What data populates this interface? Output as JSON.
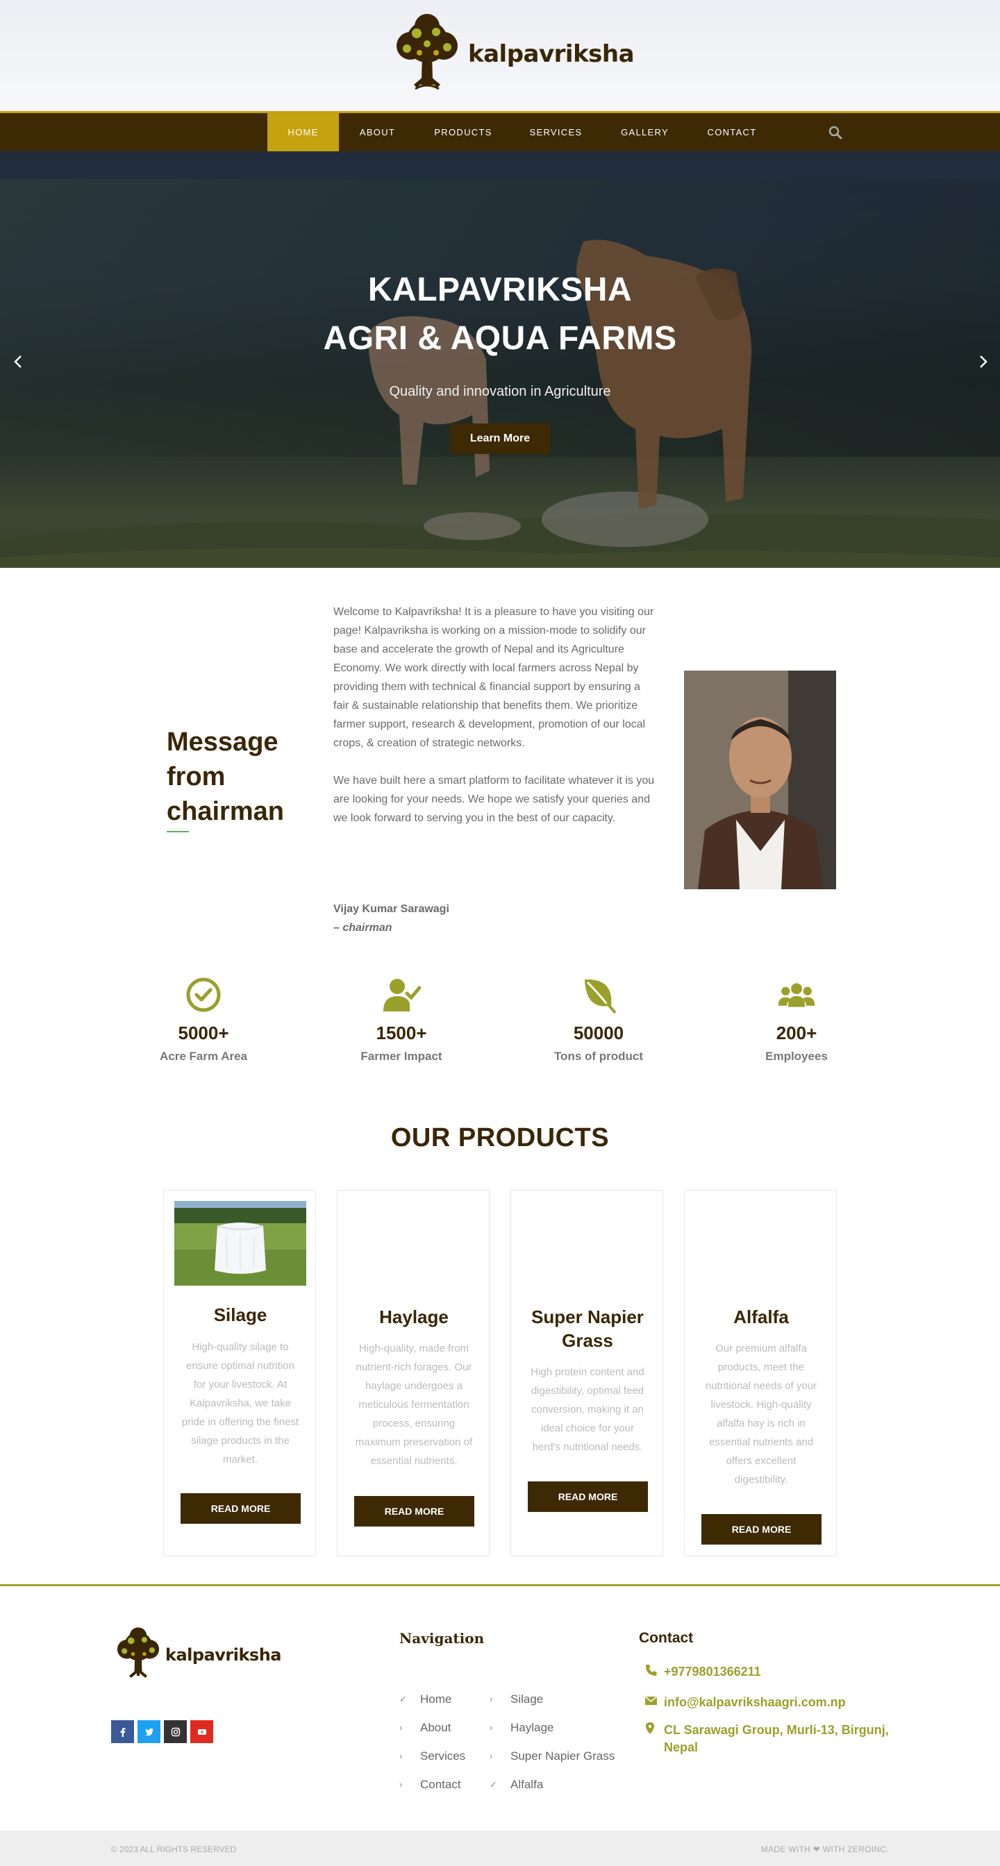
{
  "brand": {
    "name": "kalpavriksha"
  },
  "nav": {
    "items": [
      {
        "label": "HOME",
        "active": true
      },
      {
        "label": "ABOUT"
      },
      {
        "label": "PRODUCTS"
      },
      {
        "label": "SERVICES"
      },
      {
        "label": "GALLERY"
      },
      {
        "label": "CONTACT"
      }
    ],
    "search_icon": "search-icon"
  },
  "hero": {
    "title_line1": "KALPAVRIKSHA",
    "title_line2": "AGRI & AQUA FARMS",
    "subtitle": "Quality and innovation in Agriculture",
    "button": "Learn More",
    "prev_icon": "chevron-left-icon",
    "next_icon": "chevron-right-icon"
  },
  "message": {
    "heading": "Message from chairman",
    "paragraphs": [
      "Welcome to Kalpavriksha! It is a pleasure to have you visiting our page! Kalpavriksha is working on a mission-mode to solidify our base and accelerate the growth of Nepal and its Agriculture Economy. We work directly with local farmers across Nepal by providing them with technical & financial support by ensuring a fair & sustainable relationship that benefits them. We prioritize farmer support, research & development, promotion of our local crops, & creation of strategic networks.",
      "We have built here a smart platform to facilitate whatever it is you are looking for your needs. We hope we satisfy your queries and we look forward to serving you in the best of our capacity."
    ],
    "signature_name": "Vijay Kumar Sarawagi",
    "signature_role": "– chairman"
  },
  "stats": [
    {
      "icon": "check-circle-icon",
      "value": "5000+",
      "label": "Acre Farm Area"
    },
    {
      "icon": "user-check-icon",
      "value": "1500+",
      "label": "Farmer Impact"
    },
    {
      "icon": "leaf-icon",
      "value": "50000",
      "label": "Tons of product"
    },
    {
      "icon": "users-icon",
      "value": "200+",
      "label": "Employees"
    }
  ],
  "products": {
    "title": "OUR PRODUCTS",
    "items": [
      {
        "name": "Silage",
        "description": "High-quality silage to ensure optimal nutrition for your livestock. At Kalpavriksha, we take pride in offering the finest silage products in the market.",
        "button": "READ MORE"
      },
      {
        "name": "Haylage",
        "description": "High-quality, made from nutrient-rich forages. Our haylage undergoes a meticulous fermentation process, ensuring maximum preservation of essential nutrients.",
        "button": "READ MORE"
      },
      {
        "name": "Super Napier Grass",
        "description": "High protein content and digestibility, optimal feed conversion, making it an ideal choice for your herd's nutritional needs.",
        "button": "READ MORE"
      },
      {
        "name": "Alfalfa",
        "description": "Our premium alfalfa products, meet the nutritional needs of your livestock. High-quality alfalfa hay is rich in essential nutrients and offers excellent digestibility.",
        "button": "READ MORE"
      }
    ]
  },
  "footer": {
    "socials": [
      {
        "icon": "facebook-icon",
        "color": "#3b5998"
      },
      {
        "icon": "twitter-icon",
        "color": "#1da1f2"
      },
      {
        "icon": "instagram-icon",
        "color": "#333333"
      },
      {
        "icon": "youtube-icon",
        "color": "#e02a20"
      }
    ],
    "nav_title": "Navigation",
    "nav_col1": [
      "Home",
      "About",
      "Services",
      "Contact"
    ],
    "nav_col2": [
      "Silage",
      "Haylage",
      "Super Napier Grass",
      "Alfalfa"
    ],
    "contact_title": "Contact",
    "phone": "+9779801366211",
    "email": "info@kalpavrikshaagri.com.np",
    "address": "CL Sarawagi Group, Murli-13, Birgunj, Nepal",
    "copyright": "© 2023 ALL RIGHTS RESERVED",
    "made_with": "MADE WITH ❤ WITH ZEROINC."
  },
  "colors": {
    "brown": "#3d2a05",
    "gold": "#c5a20f",
    "olive": "#9aa02a"
  }
}
